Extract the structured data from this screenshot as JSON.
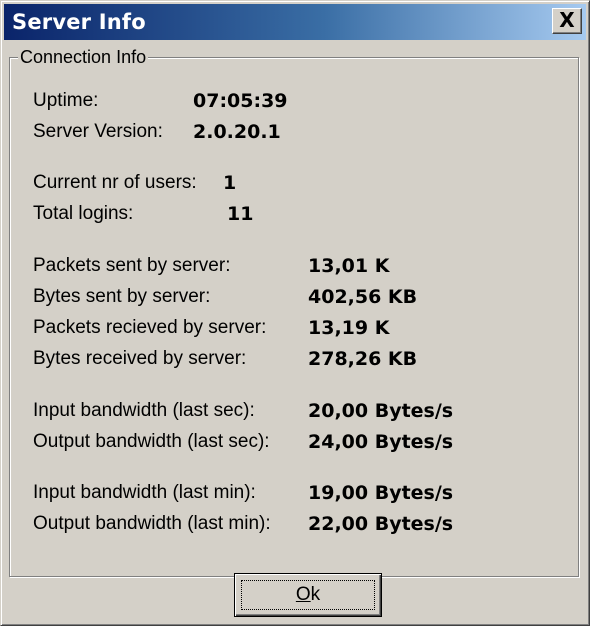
{
  "window": {
    "title": "Server Info",
    "close_label": "X"
  },
  "group": {
    "legend": "Connection Info"
  },
  "stats": {
    "uptime_label": "Uptime:",
    "uptime_value": "07:05:39",
    "server_version_label": "Server Version:",
    "server_version_value": "2.0.20.1",
    "current_users_label": "Current nr of users:",
    "current_users_value": "1",
    "total_logins_label": "Total logins:",
    "total_logins_value": "11",
    "packets_sent_label": "Packets sent by server:",
    "packets_sent_value": "13,01 K",
    "bytes_sent_label": "Bytes sent by server:",
    "bytes_sent_value": "402,56 KB",
    "packets_received_label": "Packets recieved by server:",
    "packets_received_value": "13,19 K",
    "bytes_received_label": "Bytes received by server:",
    "bytes_received_value": "278,26 KB",
    "input_bw_sec_label": "Input bandwidth (last sec):",
    "input_bw_sec_value": "20,00 Bytes/s",
    "output_bw_sec_label": "Output bandwidth (last sec):",
    "output_bw_sec_value": "24,00 Bytes/s",
    "input_bw_min_label": "Input bandwidth (last min):",
    "input_bw_min_value": "19,00 Bytes/s",
    "output_bw_min_label": "Output bandwidth (last min):",
    "output_bw_min_value": "22,00 Bytes/s"
  },
  "buttons": {
    "ok_mnemonic": "O",
    "ok_rest": "k"
  }
}
